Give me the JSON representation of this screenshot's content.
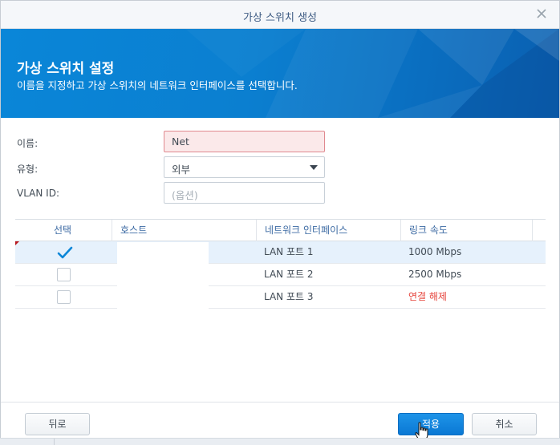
{
  "window": {
    "title": "가상 스위치 생성",
    "close_icon": "close-icon"
  },
  "banner": {
    "heading": "가상 스위치 설정",
    "subtitle": "이름을 지정하고 가상 스위치의 네트워크 인터페이스를 선택합니다."
  },
  "form": {
    "name_label": "이름:",
    "name_value": "Net",
    "type_label": "유형:",
    "type_value": "외부",
    "vlan_label": "VLAN ID:",
    "vlan_placeholder": "(옵션)"
  },
  "table": {
    "headers": [
      "선택",
      "호스트",
      "네트워크 인터페이스",
      "링크 속도"
    ],
    "rows": [
      {
        "checked": true,
        "interface": "LAN 포트 1",
        "speed": "1000 Mbps",
        "status_color": "normal"
      },
      {
        "checked": false,
        "interface": "LAN 포트 2",
        "speed": "2500 Mbps",
        "status_color": "normal"
      },
      {
        "checked": false,
        "interface": "LAN 포트 3",
        "speed": "연결 해제",
        "status_color": "#e6453d"
      }
    ]
  },
  "footer": {
    "back_label": "뒤로",
    "apply_label": "적용",
    "cancel_label": "취소"
  },
  "colors": {
    "accent": "#0a86d8",
    "header_text": "#3c6aa3",
    "error_field": "#fbe9ea",
    "disconnected": "#e6453d"
  }
}
